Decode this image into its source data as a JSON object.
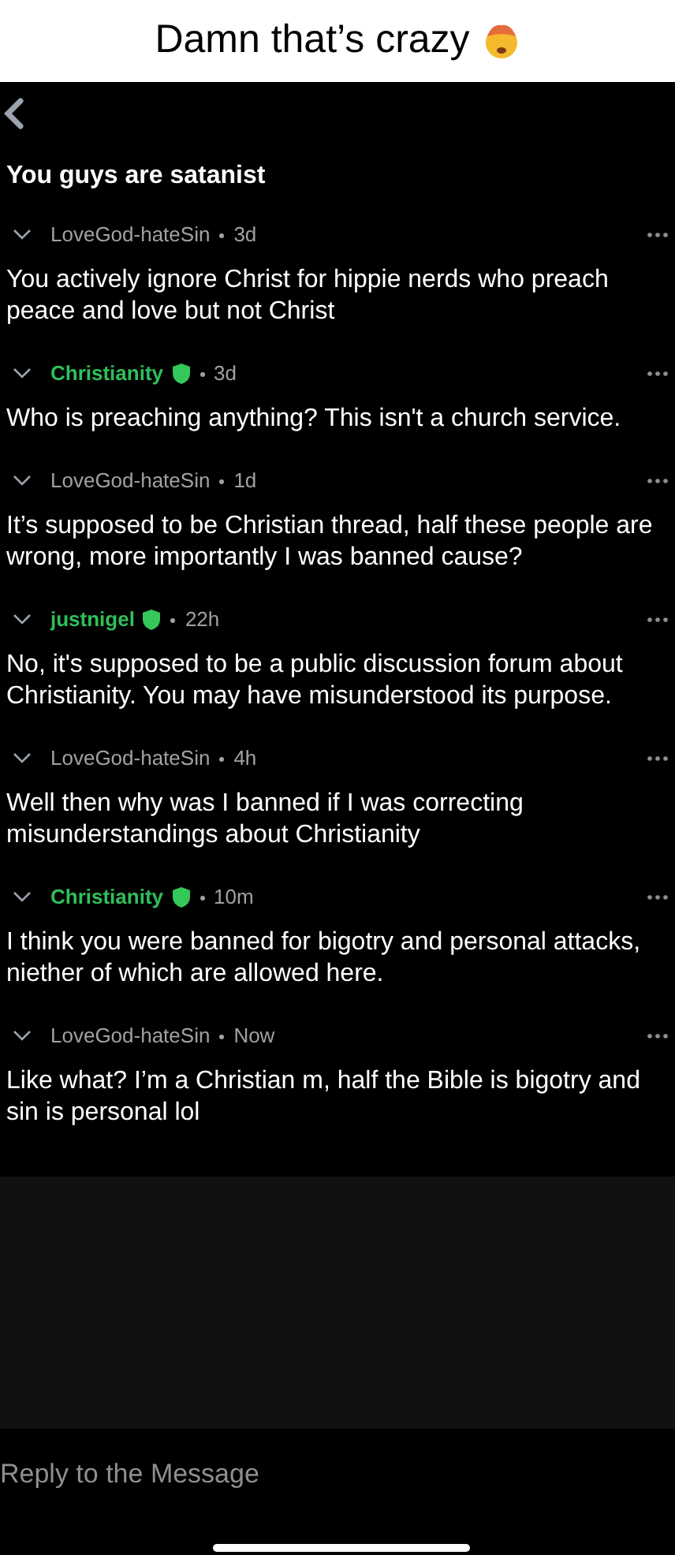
{
  "caption": "Damn that’s crazy",
  "post_title": "You guys are satanist",
  "comments": [
    {
      "author": "LoveGod-hateSin",
      "moderator": false,
      "time": "3d",
      "text": "You actively ignore Christ for hippie nerds who preach peace and love but not Christ"
    },
    {
      "author": "Christianity",
      "moderator": true,
      "time": "3d",
      "text": "Who is preaching anything? This isn't a church service."
    },
    {
      "author": "LoveGod-hateSin",
      "moderator": false,
      "time": "1d",
      "text": "It’s supposed to be Christian thread, half these people are wrong, more importantly I was banned cause?"
    },
    {
      "author": "justnigel",
      "moderator": true,
      "time": "22h",
      "text": "No, it's supposed to be a public discussion forum about Christianity. You may have misunderstood its purpose."
    },
    {
      "author": "LoveGod-hateSin",
      "moderator": false,
      "time": "4h",
      "text": "Well then why was I banned if I was correcting misunderstandings about Christianity"
    },
    {
      "author": "Christianity",
      "moderator": true,
      "time": "10m",
      "text": "I think you were banned for bigotry and personal attacks, niether of which are allowed here."
    },
    {
      "author": "LoveGod-hateSin",
      "moderator": false,
      "time": "Now",
      "text": "Like what? I’m a Christian m, half the Bible is bigotry and sin is personal lol"
    }
  ],
  "reply": {
    "placeholder": "Reply to the Message"
  }
}
